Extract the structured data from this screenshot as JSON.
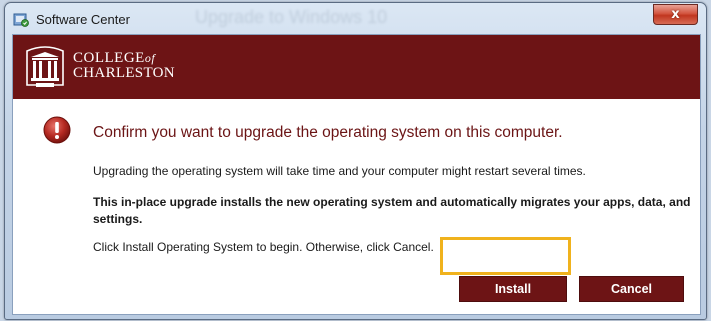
{
  "window": {
    "title": "Software Center",
    "background_title": "Upgrade to Windows 10",
    "close_glyph": "x"
  },
  "banner": {
    "logo_line1": "COLLEGE",
    "logo_of": "of",
    "logo_line2": "CHARLESTON",
    "color": "#6d1415"
  },
  "dialog": {
    "icon": "error-icon",
    "heading": "Confirm you want to upgrade the operating system on this computer.",
    "paragraph1": "Upgrading the operating system will take time and your computer might restart several times.",
    "paragraph2": "This in-place upgrade installs the new operating system and automatically migrates your apps, data, and settings.",
    "paragraph3": "Click Install Operating System to begin. Otherwise, click Cancel."
  },
  "buttons": {
    "install_label": "Install",
    "cancel_label": "Cancel"
  },
  "colors": {
    "highlight": "#f0b21d",
    "heading_text": "#6b1415"
  }
}
